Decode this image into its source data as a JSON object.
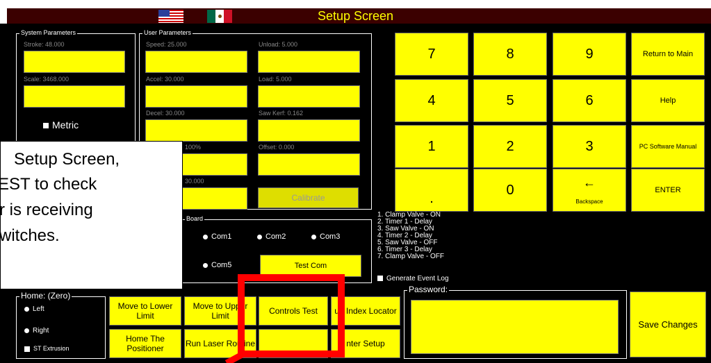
{
  "title": "Setup Screen",
  "system_params": {
    "label": "System Parameters",
    "stroke": "Stroke: 48.000",
    "scale": "Scale: 3468.000",
    "metric": "Metric"
  },
  "user_params": {
    "label": "User Parameters",
    "speed": "Speed: 25.000",
    "unload": "Unload: 5.000",
    "accel": "Accel: 30.000",
    "load": "Load: 5.000",
    "decel": "Decel: 30.000",
    "saw_kerf": "Saw Kerf: 0.162",
    "partial_100": "100%",
    "offset": "Offset: 0.000",
    "partial_30": "30.000",
    "calibrate": "Calibrate"
  },
  "board": {
    "label": "Board",
    "com1": "Com1",
    "com2": "Com2",
    "com3": "Com3",
    "com5": "Com5",
    "test_com": "Test Com"
  },
  "home": {
    "label": "Home: (Zero)",
    "left": "Left",
    "right": "Right",
    "st_extrusion": "ST Extrusion"
  },
  "bottom_buttons": {
    "move_lower": "Move to Lower Limit",
    "move_upper": "Move to Upper Limit",
    "controls_test": "Controls Test",
    "run_index": "un Index Locator",
    "home_positioner": "Home The Positioner",
    "run_laser": "Run Laser Routine",
    "blank": "",
    "center_setup": "nter Setup"
  },
  "keypad": {
    "k7": "7",
    "k8": "8",
    "k9": "9",
    "k4": "4",
    "k5": "5",
    "k6": "6",
    "k1": "1",
    "k2": "2",
    "k3": "3",
    "kdot": ".",
    "k0": "0",
    "backspace_arrow": "←",
    "backspace": "Backspace",
    "return_main": "Return to Main",
    "help": "Help",
    "pc_manual": "PC Software Manual",
    "enter": "ENTER"
  },
  "sequence": [
    "1. Clamp Valve - ON",
    "2. Timer 1 - Delay",
    "3. Saw Valve - ON",
    "4. Timer 2 - Delay",
    "5. Saw Valve - OFF",
    "6. Timer 3 - Delay",
    "7. Clamp Valve - OFF"
  ],
  "event_log": "Generate Event Log",
  "password": {
    "label": "Password:",
    "value": ""
  },
  "save_changes": "Save Changes",
  "callout": {
    "line1": "Setup Screen,",
    "line2": "EST to check",
    "line3": "r is receiving",
    "line4": "witches."
  },
  "colors": {
    "button": "#ffff00",
    "title_bar": "#3b0000",
    "title_text": "#ffff00",
    "highlight": "#ff0000"
  }
}
